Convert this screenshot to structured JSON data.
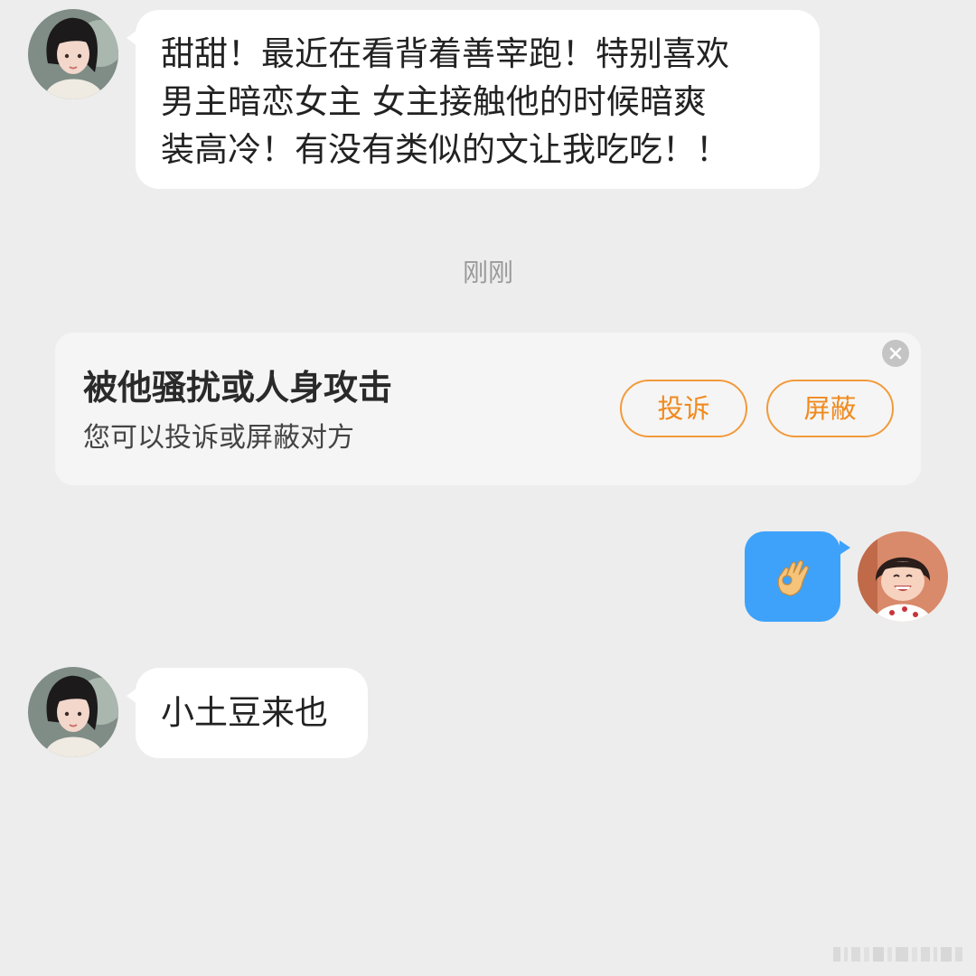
{
  "chat": {
    "messages": [
      {
        "sender": "other",
        "text": "甜甜！最近在看背着善宰跑！特别喜欢\n男主暗恋女主 女主接触他的时候暗爽\n装高冷！有没有类似的文让我吃吃！！"
      },
      {
        "sender": "self",
        "emoji": "ok-hand-emoji"
      },
      {
        "sender": "other",
        "text": "小土豆来也"
      }
    ],
    "timestamp": "刚刚"
  },
  "warning": {
    "title": "被他骚扰或人身攻击",
    "subtitle": "您可以投诉或屏蔽对方",
    "report_label": "投诉",
    "block_label": "屏蔽",
    "close_icon": "close-icon"
  },
  "colors": {
    "background": "#ededed",
    "bubble_other": "#ffffff",
    "bubble_self": "#3ea2fb",
    "accent_orange": "#f08a1e",
    "timestamp": "#9a9a9a"
  },
  "icons": {
    "avatar_other": "avatar-girl-icon",
    "avatar_self": "avatar-child-icon",
    "emoji": "ok-hand-emoji-icon"
  }
}
